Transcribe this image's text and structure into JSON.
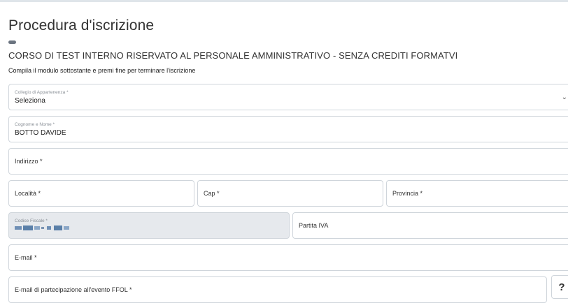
{
  "page": {
    "title": "Procedura d'iscrizione",
    "course": "CORSO DI TEST INTERNO RISERVATO AL PERSONALE AMMINISTRATIVO - SENZA CREDITI FORMATVI",
    "instructions": "Compila il modulo sottostante e premi fine per terminare l'iscrizione"
  },
  "form": {
    "collegio": {
      "label": "Collegio di Appartenenza *",
      "value": "Seleziona"
    },
    "cognome_nome": {
      "label": "Cognome e Nome *",
      "value": "BOTTO DAVIDE"
    },
    "indirizzo": {
      "placeholder": "Indirizzo *"
    },
    "localita": {
      "placeholder": "Località *"
    },
    "cap": {
      "placeholder": "Cap *"
    },
    "provincia": {
      "placeholder": "Provincia *"
    },
    "codice_fiscale": {
      "label": "Codice Fiscale *"
    },
    "partita_iva": {
      "placeholder": "Partita IVA"
    },
    "email": {
      "placeholder": "E-mail *"
    },
    "email_evento": {
      "placeholder": "E-mail di partecipazione all'evento FFOL *"
    },
    "help_label": "?"
  },
  "icons": {
    "select_chevron": "chevron-down-icon"
  }
}
